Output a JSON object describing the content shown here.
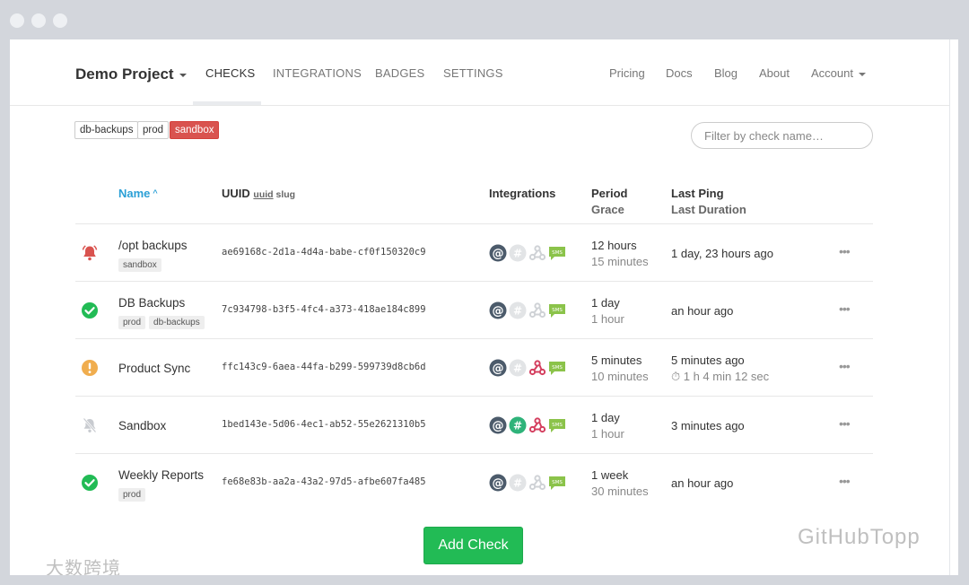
{
  "nav": {
    "brand": "Demo Project",
    "tabs": [
      "CHECKS",
      "INTEGRATIONS",
      "BADGES",
      "SETTINGS"
    ],
    "right": [
      "Pricing",
      "Docs",
      "Blog",
      "About",
      "Account"
    ]
  },
  "tags": [
    "db-backups",
    "prod",
    "sandbox"
  ],
  "filter": {
    "placeholder": "Filter by check name…"
  },
  "table": {
    "headers": {
      "name": "Name",
      "uuid": "UUID",
      "uuid_opt1": "uuid",
      "uuid_opt2": "slug",
      "integrations": "Integrations",
      "period": "Period",
      "grace": "Grace",
      "last_ping": "Last Ping",
      "last_duration": "Last Duration"
    },
    "rows": [
      {
        "status": "alert-bell-icon",
        "name": "/opt backups",
        "tags": [
          "sandbox"
        ],
        "uuid": "ae69168c-2d1a-4d4a-babe-cf0f150320c9",
        "integrations": {
          "email": true,
          "slack": false,
          "webhook": false,
          "sms": true
        },
        "period": "12 hours",
        "grace": "15 minutes",
        "last_ping": "1 day, 23 hours ago",
        "last_duration": ""
      },
      {
        "status": "check-circle-icon",
        "name": "DB Backups",
        "tags": [
          "prod",
          "db-backups"
        ],
        "uuid": "7c934798-b3f5-4fc4-a373-418ae184c899",
        "integrations": {
          "email": true,
          "slack": false,
          "webhook": false,
          "sms": true
        },
        "period": "1 day",
        "grace": "1 hour",
        "last_ping": "an hour ago",
        "last_duration": ""
      },
      {
        "status": "exclamation-circle-icon",
        "name": "Product Sync",
        "tags": [],
        "uuid": "ffc143c9-6aea-44fa-b299-599739d8cb6d",
        "integrations": {
          "email": true,
          "slack": false,
          "webhook": true,
          "sms": true
        },
        "period": "5 minutes",
        "grace": "10 minutes",
        "last_ping": "5 minutes ago",
        "last_duration": "⏱ 1 h 4 min 12 sec"
      },
      {
        "status": "paused-bell-icon",
        "name": "Sandbox",
        "tags": [],
        "uuid": "1bed143e-5d06-4ec1-ab52-55e2621310b5",
        "integrations": {
          "email": true,
          "slack": true,
          "webhook": true,
          "sms": true
        },
        "period": "1 day",
        "grace": "1 hour",
        "last_ping": "3 minutes ago",
        "last_duration": ""
      },
      {
        "status": "check-circle-icon",
        "name": "Weekly Reports",
        "tags": [
          "prod"
        ],
        "uuid": "fe68e83b-aa2a-43a2-97d5-afbe607fa485",
        "integrations": {
          "email": true,
          "slack": false,
          "webhook": false,
          "sms": true
        },
        "period": "1 week",
        "grace": "30 minutes",
        "last_ping": "an hour ago",
        "last_duration": ""
      }
    ],
    "row_menu": "•••"
  },
  "add_button": "Add Check",
  "watermarks": {
    "left": "大数跨境",
    "right": "GitHubTopp"
  },
  "colors": {
    "link_blue": "#2a9fd6",
    "danger_red": "#d9534f",
    "success_green": "#22bb55",
    "warning_orange": "#f0ad4e",
    "integration_dark": "#4c5b6b",
    "webhook_red": "#d43f5f",
    "slack_green": "#2fb37a",
    "sms_green": "#8bc34a"
  }
}
